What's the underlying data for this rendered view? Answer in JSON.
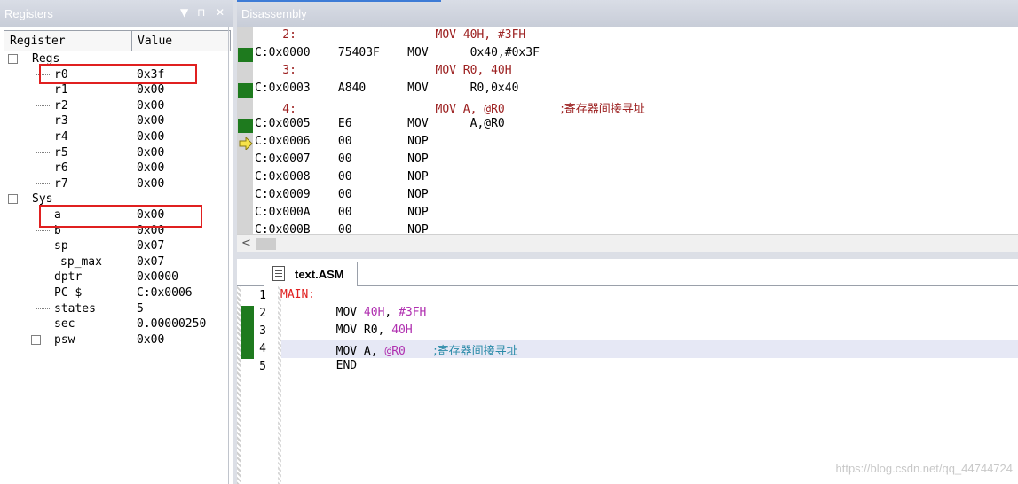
{
  "registers": {
    "title": "Registers",
    "controls": [
      "▼",
      "⊓",
      "✕"
    ],
    "columns": [
      "Register",
      "Value"
    ],
    "groups": [
      {
        "label": "Regs",
        "items": [
          {
            "name": "r0",
            "value": "0x3f"
          },
          {
            "name": "r1",
            "value": "0x00"
          },
          {
            "name": "r2",
            "value": "0x00"
          },
          {
            "name": "r3",
            "value": "0x00"
          },
          {
            "name": "r4",
            "value": "0x00"
          },
          {
            "name": "r5",
            "value": "0x00"
          },
          {
            "name": "r6",
            "value": "0x00"
          },
          {
            "name": "r7",
            "value": "0x00"
          }
        ]
      },
      {
        "label": "Sys",
        "items": [
          {
            "name": "a",
            "value": "0x00"
          },
          {
            "name": "b",
            "value": "0x00"
          },
          {
            "name": "sp",
            "value": "0x07"
          },
          {
            "name": "sp_max",
            "value": "0x07"
          },
          {
            "name": "dptr",
            "value": "0x0000"
          },
          {
            "name": "PC  $",
            "value": "C:0x0006"
          },
          {
            "name": "states",
            "value": "5"
          },
          {
            "name": "sec",
            "value": "0.00000250"
          },
          {
            "name": "psw",
            "value": "0x00"
          }
        ]
      }
    ]
  },
  "disassembly": {
    "title": "Disassembly",
    "lines": [
      {
        "kind": "src",
        "text": "    2:                    MOV 40H, #3FH",
        "mark": false,
        "arrow": false
      },
      {
        "kind": "asm",
        "text": "C:0x0000    75403F    MOV      0x40,#0x3F",
        "mark": true,
        "arrow": false
      },
      {
        "kind": "src",
        "text": "    3:                    MOV R0, 40H",
        "mark": false,
        "arrow": false
      },
      {
        "kind": "asm",
        "text": "C:0x0003    A840      MOV      R0,0x40",
        "mark": true,
        "arrow": false
      },
      {
        "kind": "src",
        "text": "    4:                    MOV A, @R0        ",
        "comment": ";寄存器间接寻址",
        "mark": false,
        "arrow": false
      },
      {
        "kind": "asm",
        "text": "C:0x0005    E6        MOV      A,@R0",
        "mark": true,
        "arrow": false
      },
      {
        "kind": "asm",
        "text": "C:0x0006    00        NOP",
        "mark": false,
        "arrow": true
      },
      {
        "kind": "asm",
        "text": "C:0x0007    00        NOP",
        "mark": false,
        "arrow": false
      },
      {
        "kind": "asm",
        "text": "C:0x0008    00        NOP",
        "mark": false,
        "arrow": false
      },
      {
        "kind": "asm",
        "text": "C:0x0009    00        NOP",
        "mark": false,
        "arrow": false
      },
      {
        "kind": "asm",
        "text": "C:0x000A    00        NOP",
        "mark": false,
        "arrow": false
      },
      {
        "kind": "asm",
        "text": "C:0x000B    00        NOP",
        "mark": false,
        "arrow": false
      }
    ],
    "scroll_left": "<"
  },
  "editor": {
    "tab_label": "text.ASM",
    "lines": [
      {
        "n": "1",
        "mark": false,
        "parts": [
          {
            "c": "lbl",
            "t": "MAIN:"
          }
        ]
      },
      {
        "n": "2",
        "mark": true,
        "parts": [
          {
            "c": "kw",
            "t": "        MOV "
          },
          {
            "c": "num",
            "t": "40H"
          },
          {
            "c": "kw",
            "t": ", "
          },
          {
            "c": "num",
            "t": "#3FH"
          }
        ]
      },
      {
        "n": "3",
        "mark": true,
        "parts": [
          {
            "c": "kw",
            "t": "        MOV R0, "
          },
          {
            "c": "num",
            "t": "40H"
          }
        ]
      },
      {
        "n": "4",
        "mark": true,
        "parts": [
          {
            "c": "kw",
            "t": "        MOV A, "
          },
          {
            "c": "num",
            "t": "@R0"
          },
          {
            "c": "kw",
            "t": "    "
          },
          {
            "c": "cmt",
            "t": ";寄存器间接寻址"
          }
        ]
      },
      {
        "n": "5",
        "mark": false,
        "parts": [
          {
            "c": "kw",
            "t": "        END"
          }
        ]
      }
    ]
  },
  "watermark": "https://blog.csdn.net/qq_44744724",
  "colors": {
    "exec_mark": "#1e7a1e",
    "highlight_box": "#e02020",
    "source_text": "#9c2020"
  }
}
